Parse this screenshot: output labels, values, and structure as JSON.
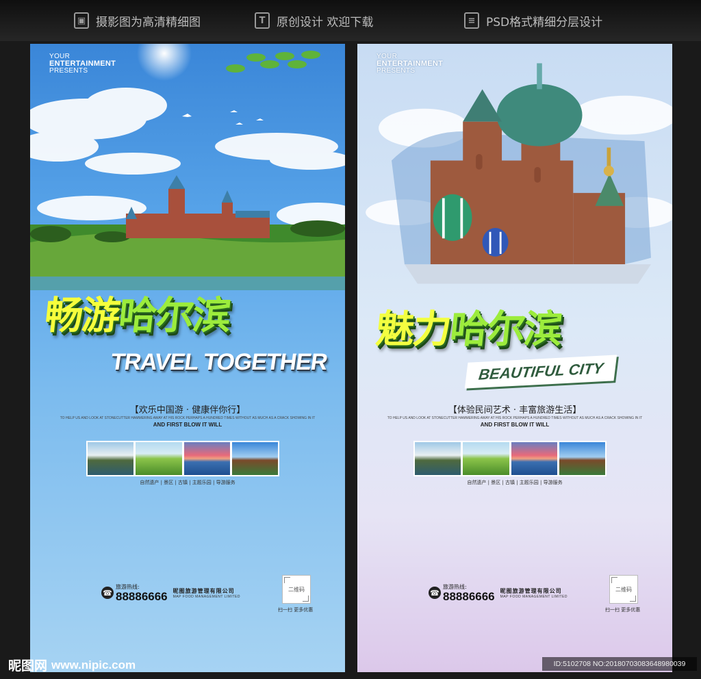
{
  "features": [
    {
      "icon": "image-icon",
      "label": "摄影图为高清精细图"
    },
    {
      "icon": "text-icon",
      "label": "原创设计 欢迎下载"
    },
    {
      "icon": "layers-icon",
      "label": "PSD格式精细分层设计"
    }
  ],
  "posters": [
    {
      "brand_top": "YOUR",
      "brand_mid": "ENTERTAINMENT",
      "brand_bot": "PRESENTS",
      "title_a": "畅游",
      "title_b": "哈尔滨",
      "banner": "TRAVEL TOGETHER",
      "slogan": "【欢乐中国游 · 健康伴你行】",
      "fine_text": "TO HELP US AND LOOK AT STONECUTTER HAMMERING AWAY AT HIS ROCK PERHAPS A HUNDRED TIMES WITHOUT AS MUCH AS A CRACK SHOWING IN IT",
      "fine_lead": "AND FIRST BLOW IT WILL",
      "categories": "自然遗产 | 景区 | 古镇 | 主题乐园 | 导游服务",
      "hotline_label": "旅游热线:",
      "hotline": "88886666",
      "company": "昵图旅游管理有限公司",
      "company_en": "MAP FOOD MANAGEMENT LIMITED",
      "qr_label": "二维码",
      "qr_caption": "扫一扫  更多优惠"
    },
    {
      "brand_top": "YOUR",
      "brand_mid": "ENTERTAINMENT",
      "brand_bot": "PRESENTS",
      "title_a": "魅力",
      "title_b": "哈尔滨",
      "banner": "BEAUTIFUL CITY",
      "slogan": "【体验民间艺术 · 丰富旅游生活】",
      "fine_text": "TO HELP US AND LOOK AT STONECUTTER HAMMERING AWAY AT HIS ROCK PERHAPS A HUNDRED TIMES WITHOUT AS MUCH AS A CRACK SHOWING IN IT",
      "fine_lead": "AND FIRST BLOW IT WILL",
      "categories": "自然遗产 | 景区 | 古镇 | 主题乐园 | 导游服务",
      "hotline_label": "旅游热线:",
      "hotline": "88886666",
      "company": "昵图旅游管理有限公司",
      "company_en": "MAP FOOD MANAGEMENT LIMITED",
      "qr_label": "二维码",
      "qr_caption": "扫一扫  更多优惠"
    }
  ],
  "watermark": {
    "site_cn": "昵图网",
    "site_url": "www.nipic.com",
    "id_text": "ID:5102708 NO:20180703083648980039"
  }
}
